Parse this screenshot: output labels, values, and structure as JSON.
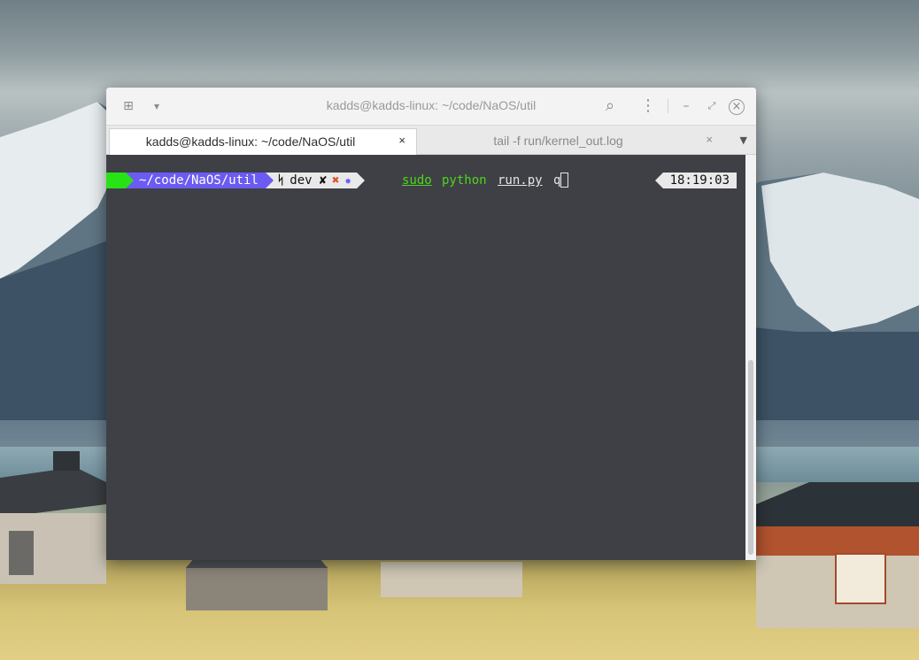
{
  "window": {
    "title": "kadds@kadds-linux: ~/code/NaOS/util",
    "buttons": {
      "new_tab": "⊞",
      "menu_drop": "▾",
      "search": "⌕",
      "more": "⋮",
      "minimize": "–",
      "restore": "⤢",
      "close": "×"
    }
  },
  "tabs": [
    {
      "label": "kadds@kadds-linux: ~/code/NaOS/util",
      "close": "×",
      "active": true
    },
    {
      "label": "tail -f run/kernel_out.log",
      "close": "×",
      "active": false
    }
  ],
  "tab_menu": "▼",
  "prompt": {
    "path": "~/code/NaOS/util",
    "branch_icon": "ᛋ",
    "branch": "dev",
    "status_marks": [
      "✘",
      "✖",
      "✸"
    ],
    "colors": {
      "status_green": "#27e315",
      "path_bg": "#6b5bf2",
      "git_bg": "#e9e9e9",
      "dirty": "#e0502a",
      "untracked": "#6b5bf2"
    }
  },
  "command": {
    "words": [
      "sudo",
      "python",
      "run.py",
      "q"
    ]
  },
  "clock": "18:19:03"
}
